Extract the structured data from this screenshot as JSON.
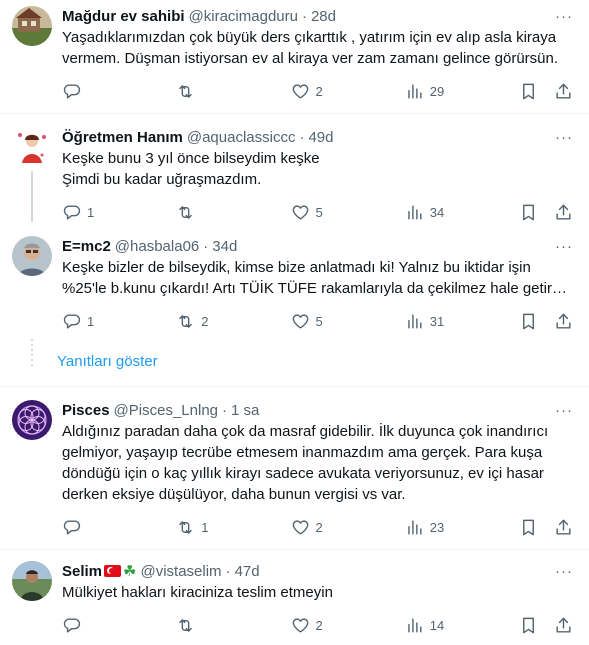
{
  "tweets": [
    {
      "name": "Mağdur ev sahibi",
      "handle": "@kiracimagduru",
      "time": "28d",
      "text": "Yaşadıklarımızdan çok büyük ders çıkarttık , yatırım için ev alıp asla kiraya vermem. Düşman istiyorsan ev al kiraya ver zam zamanı gelince görürsün.",
      "replies": "",
      "retweets": "",
      "likes": "2",
      "views": "29",
      "avatar_color": "#8a6a4a"
    },
    {
      "name": "Öğretmen Hanım",
      "handle": "@aquaclassiccc",
      "time": "49d",
      "text": "Keşke bunu 3 yıl önce bilseydim keşke\nŞimdi bu kadar uğraşmazdım.",
      "replies": "1",
      "retweets": "",
      "likes": "5",
      "views": "34",
      "avatar_color": "#d9342b"
    },
    {
      "name": "E=mc2",
      "handle": "@hasbala06",
      "time": "34d",
      "text": "Keşke bizler de bilseydik, kimse bize anlatmadı ki! Yalnız bu iktidar işin\n%25'le b.kunu çıkardı! Artı TÜİK TÜFE rakamlarıyla da çekilmez hale getirdi...",
      "replies": "1",
      "retweets": "2",
      "likes": "5",
      "views": "31",
      "avatar_color": "#7a8a9a"
    },
    {
      "name": "Pisces",
      "handle": "@Pisces_Lnlng",
      "time": "1 sa",
      "text": "Aldığınız paradan daha çok da masraf gidebilir. İlk duyunca çok inandırıcı gelmiyor, yaşayıp tecrübe etmesem inanmazdım ama gerçek. Para kuşa döndüğü için o kaç yıllık kirayı sadece avukata veriyorsunuz, ev içi hasar derken eksiye düşülüyor, daha bunun vergisi vs var.",
      "replies": "",
      "retweets": "1",
      "likes": "2",
      "views": "23",
      "avatar_color": "#6a3fb0"
    },
    {
      "name": "Selim",
      "handle": "@vistaselim",
      "time": "47d",
      "text": "Mülkiyet hakları kiraciniza teslim etmeyin",
      "replies": "",
      "retweets": "",
      "likes": "2",
      "views": "14",
      "avatar_color": "#4a6a3a"
    }
  ],
  "show_replies_label": "Yanıtları göster",
  "more_label": "···",
  "colors": {
    "link": "#1d9bf0",
    "secondary": "#536471",
    "divider": "#eff3f4"
  }
}
